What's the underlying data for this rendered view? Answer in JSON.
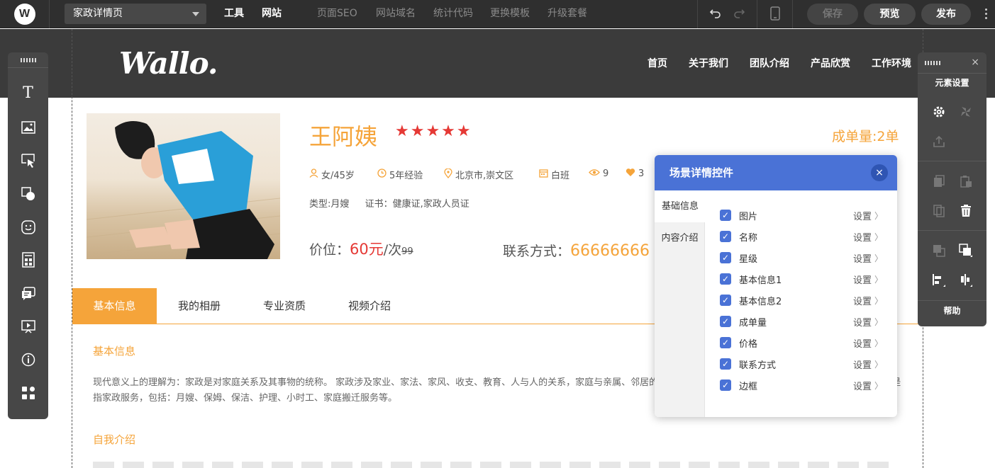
{
  "topbar": {
    "page_select": "家政详情页",
    "menu_main": [
      "工具",
      "网站"
    ],
    "menu_dim": [
      "页面SEO",
      "网站域名",
      "统计代码",
      "更换模板",
      "升级套餐"
    ],
    "save": "保存",
    "preview": "预览",
    "publish": "发布"
  },
  "site": {
    "brand": "Wallo.",
    "nav": [
      "首页",
      "关于我们",
      "团队介绍",
      "产品欣赏",
      "工作环境"
    ]
  },
  "palette": {
    "text_icon": "T"
  },
  "element_settings": {
    "title": "元素设置",
    "help": "帮助"
  },
  "profile": {
    "name": "王阿姨",
    "stars": "★★★★★",
    "rating": 5,
    "orders": "成单量:2单",
    "info": {
      "gender_age": "女/45岁",
      "experience": "5年经验",
      "location": "北京市,崇文区",
      "shift": "白班",
      "views": "9",
      "likes": "3"
    },
    "type": "类型:月嫂",
    "cert": "证书：健康证,家政人员证",
    "price_label": "价位：",
    "price_value": "60元",
    "price_unit": "/次",
    "price_old": "99",
    "contact_label": "联系方式：",
    "contact_value": "66666666"
  },
  "tabs": [
    "基本信息",
    "我的相册",
    "专业资质",
    "视频介绍"
  ],
  "content": {
    "basic_title": "基本信息",
    "basic_text": "现代意义上的理解为：家政是对家庭关系及其事物的统称。 家政涉及家业、家法、家风、收支、教育、人与人的关系，家庭与亲属、邻居的关系，家庭成员与社会的关系等。 现代意义上的家政主要是指家政服务，包括：月嫂、保姆、保洁、护理、小时工、家庭搬迁服务等。",
    "intro_title": "自我介绍"
  },
  "panel": {
    "title": "场景详情控件",
    "close": "×",
    "side_tabs": [
      "基础信息",
      "内容介绍"
    ],
    "set_label": "设置",
    "chevron": "〉",
    "options": [
      "图片",
      "名称",
      "星级",
      "基本信息1",
      "基本信息2",
      "成单量",
      "价格",
      "联系方式",
      "边框"
    ]
  }
}
